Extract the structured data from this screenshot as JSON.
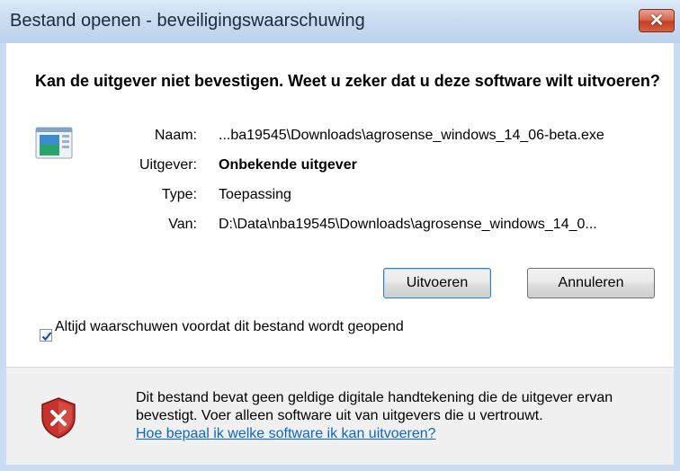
{
  "window": {
    "title": "Bestand openen - beveiligingswaarschuwing",
    "close_glyph": "✕"
  },
  "heading": "Kan de uitgever niet bevestigen. Weet u zeker dat u deze software wilt uitvoeren?",
  "file_icon": "application-icon",
  "properties": {
    "name_label": "Naam:",
    "name_value": "...ba19545\\Downloads\\agrosense_windows_14_06-beta.exe",
    "publisher_label": "Uitgever:",
    "publisher_value": "Onbekende uitgever",
    "type_label": "Type:",
    "type_value": "Toepassing",
    "from_label": "Van:",
    "from_value": "D:\\Data\\nba19545\\Downloads\\agrosense_windows_14_0..."
  },
  "buttons": {
    "run": "Uitvoeren",
    "cancel": "Annuleren"
  },
  "checkbox": {
    "checked": true,
    "label": "Altijd waarschuwen voordat dit bestand wordt geopend"
  },
  "warning": {
    "icon": "shield-error-icon",
    "text": "Dit bestand bevat geen geldige digitale handtekening die de uitgever ervan bevestigt. Voer alleen software uit van uitgevers die u vertrouwt.",
    "link": "Hoe bepaal ik welke software ik kan uitvoeren?"
  },
  "colors": {
    "title_bar": "#c8daf0",
    "close_button": "#c23f25",
    "link": "#0b66cc",
    "footer_bg": "#f0f0f0"
  }
}
